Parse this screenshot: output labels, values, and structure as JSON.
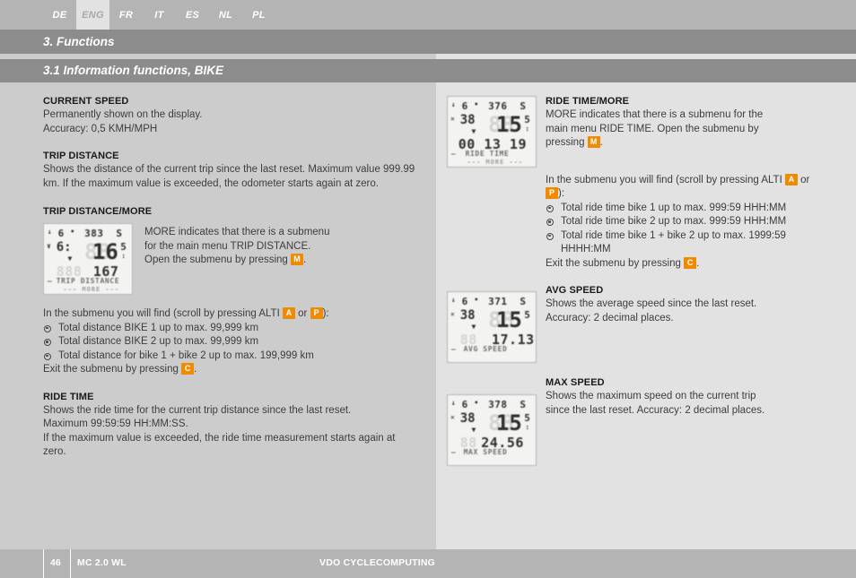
{
  "language_tabs": [
    {
      "label": "DE",
      "active": false
    },
    {
      "label": "ENG",
      "active": true
    },
    {
      "label": "FR",
      "active": false
    },
    {
      "label": "IT",
      "active": false
    },
    {
      "label": "ES",
      "active": false
    },
    {
      "label": "NL",
      "active": false
    },
    {
      "label": "PL",
      "active": false
    }
  ],
  "chapter": {
    "title": "3.  Functions"
  },
  "section": {
    "title": "3.1   Information functions, BIKE"
  },
  "left_column": {
    "current_speed": {
      "heading": "CURRENT SPEED",
      "line1": "Permanently shown on the display.",
      "line2": "Accuracy: 0,5 KMH/MPH"
    },
    "trip_distance": {
      "heading": "TRIP DISTANCE",
      "body": "Shows the distance of the current trip since the last reset. Maximum value 999.99 km. If the maximum value is exceeded, the odometer starts again at zero."
    },
    "trip_distance_more": {
      "heading": "TRIP DISTANCE/MORE",
      "body_a": "MORE indicates that there is a submenu",
      "body_b": "for the main menu TRIP DISTANCE.",
      "body_c": "Open the submenu by pressing ",
      "key_m": "M",
      "body_d": ".",
      "lcd": {
        "alti_label": "6",
        "top_value": "383",
        "top_unit": "S",
        "clock": "6:",
        "big_value": "16",
        "big_small": "5",
        "low_value": "167",
        "name": "TRIP DISTANCE",
        "more": "--- MORE ---"
      }
    },
    "submenu": {
      "intro_a": "In the submenu you will find (scroll by pressing ALTI ",
      "key_a": "A",
      "intro_b": " or ",
      "key_p": "P",
      "intro_c": "):",
      "items": [
        "Total distance BIKE 1 up to max. 99,999 km",
        "Total distance BIKE 2 up to max. 99,999 km",
        "Total distance for bike 1 + bike 2 up to max. 199,999 km"
      ],
      "exit_a": "Exit the submenu by pressing ",
      "key_c": "C",
      "exit_b": "."
    },
    "ride_time": {
      "heading": "RIDE TIME",
      "line1": "Shows the ride time for the current trip distance since the last reset.",
      "line2": "Maximum 99:59:59 HH:MM:SS.",
      "line3": "If the maximum value is exceeded, the ride time measurement starts again at zero."
    }
  },
  "right_column": {
    "ride_time_more": {
      "heading": "RIDE TIME/MORE",
      "body_a": "MORE indicates that there is a submenu for the",
      "body_b": "main menu RIDE TIME. Open the submenu by",
      "body_c": "pressing ",
      "key_m": "M",
      "body_d": ".",
      "lcd": {
        "alti_label": "6",
        "top_value": "376",
        "top_unit": "S",
        "clock": "38",
        "big_value": "15",
        "big_small": "5",
        "low_value": "00 13 19",
        "name": "RIDE TIME",
        "more": "--- MORE ---"
      }
    },
    "submenu": {
      "intro_a": "In the submenu you will find (scroll by pressing ALTI ",
      "key_a": "A",
      "intro_b": " or ",
      "key_p": "P",
      "intro_c": "):",
      "items": [
        "Total ride time bike 1 up to max. 999:59 HHH:MM",
        "Total ride time bike 2 up to max. 999:59 HHH:MM",
        "Total ride time bike 1 + bike 2 up to max. 1999:59 HHHH:MM"
      ],
      "exit_a": "Exit the submenu by pressing ",
      "key_c": "C",
      "exit_b": "."
    },
    "avg_speed": {
      "heading": "AVG SPEED",
      "line1": "Shows the average speed since the last reset.",
      "line2": "Accuracy: 2 decimal places.",
      "lcd": {
        "alti_label": "6",
        "top_value": "371",
        "top_unit": "S",
        "clock": "38",
        "big_value": "15",
        "big_small": "5",
        "low_value": "17.13",
        "name": "AVG SPEED",
        "more": ""
      }
    },
    "max_speed": {
      "heading": "MAX SPEED",
      "line1": "Shows the maximum speed on the current trip",
      "line2": "since the last reset. Accuracy: 2 decimal places.",
      "lcd": {
        "alti_label": "6",
        "top_value": "378",
        "top_unit": "S",
        "clock": "38",
        "big_value": "15",
        "big_small": "5",
        "low_value": "24.56",
        "name": "MAX SPEED",
        "more": ""
      }
    }
  },
  "footer": {
    "page_number": "46",
    "model": "MC 2.0 WL",
    "brand": "VDO CYCLECOMPUTING"
  },
  "colors": {
    "key_badge": "#f08a00",
    "bar_gray": "#8c8c8c",
    "tab_gray": "#b4b4b4",
    "left_bg": "#cccccc",
    "right_bg": "#e2e2e2"
  }
}
